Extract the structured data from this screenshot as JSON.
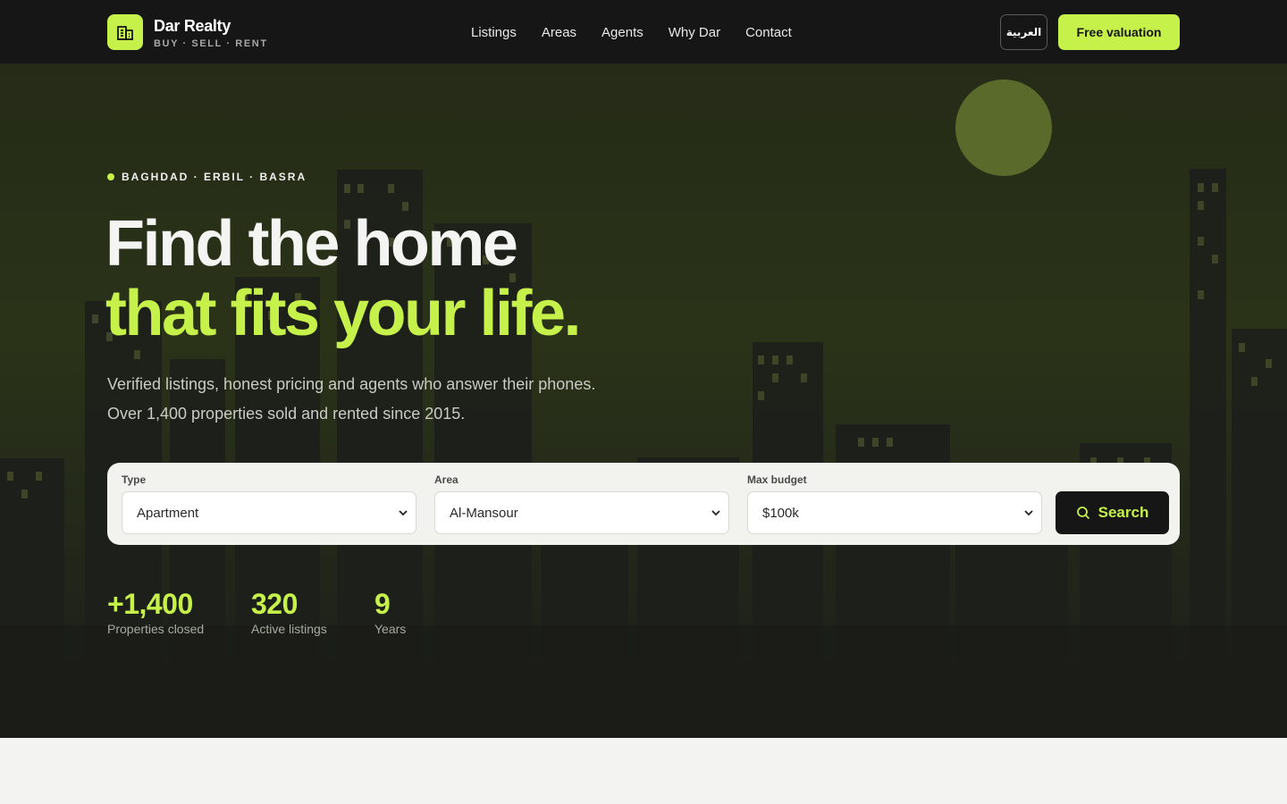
{
  "header": {
    "brand_name": "Dar Realty",
    "brand_tagline": "BUY · SELL · RENT",
    "logo_icon": "building-icon",
    "nav": [
      {
        "label": "Listings"
      },
      {
        "label": "Areas"
      },
      {
        "label": "Agents"
      },
      {
        "label": "Why Dar"
      },
      {
        "label": "Contact"
      }
    ],
    "lang_label": "العربية",
    "cta_label": "Free valuation"
  },
  "hero": {
    "eyebrow": "BAGHDAD · ERBIL · BASRA",
    "title_line1": "Find the home",
    "title_line2": "that fits your life.",
    "subtitle_line1": "Verified listings, honest pricing and agents who answer their phones.",
    "subtitle_line2": "Over 1,400 properties sold and rented since 2015."
  },
  "search": {
    "type_label": "Type",
    "type_value": "Apartment",
    "area_label": "Area",
    "area_value": "Al-Mansour",
    "budget_label": "Max budget",
    "budget_value": "$100k",
    "button_label": "Search",
    "button_icon": "search-icon"
  },
  "stats": [
    {
      "value": "+1,400",
      "label": "Properties closed"
    },
    {
      "value": "320",
      "label": "Active listings"
    },
    {
      "value": "9",
      "label": "Years"
    }
  ],
  "colors": {
    "accent": "#c6f04a",
    "dark": "#161616",
    "hero_bg": "#2a3318",
    "light_bg": "#f3f3f1"
  }
}
